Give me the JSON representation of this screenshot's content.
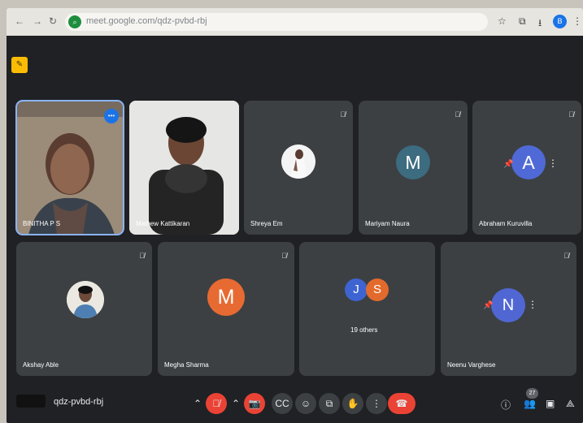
{
  "browser": {
    "url": "meet.google.com/qdz-pvbd-rbj"
  },
  "participants": [
    {
      "name": "BINITHA P S",
      "type": "video"
    },
    {
      "name": "Mathew Kattikaran",
      "type": "video"
    },
    {
      "name": "Shreya Em",
      "type": "photo"
    },
    {
      "name": "Mariyam Naura",
      "initial": "M",
      "color": "#3d6b7f"
    },
    {
      "name": "Abraham Kuruvilla",
      "initial": "A",
      "color": "#4f6ad6"
    },
    {
      "name": "Akshay Able",
      "type": "photo"
    },
    {
      "name": "Megha Sharma",
      "initial": "M",
      "color": "#e76a32"
    },
    {
      "group_initials": [
        "J",
        "S"
      ],
      "label": "19 others"
    },
    {
      "name": "Neenu Varghese",
      "initial": "N",
      "color": "#5067d3"
    }
  ],
  "bottom_bar": {
    "meeting_code": "qdz-pvbd-rbj",
    "participant_count": "27"
  }
}
